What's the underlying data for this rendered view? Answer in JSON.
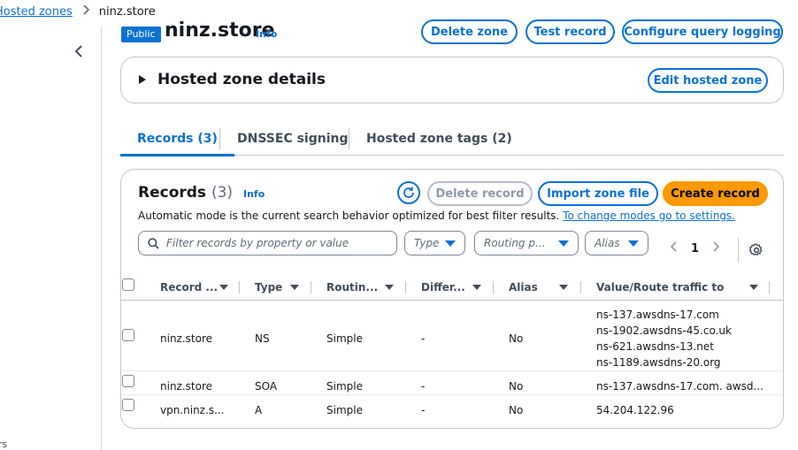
{
  "breadcrumb": {
    "parent": "Hosted zones",
    "current": "ninz.store"
  },
  "left_rail": {
    "fragment": "rs"
  },
  "header": {
    "badge": "Public",
    "title": "ninz.store",
    "info": "Info",
    "buttons": {
      "delete_zone": "Delete zone",
      "test_record": "Test record",
      "configure_logging": "Configure query logging"
    }
  },
  "details": {
    "title": "Hosted zone details",
    "edit_button": "Edit hosted zone"
  },
  "tabs": [
    {
      "label": "Records (3)",
      "active": true
    },
    {
      "label": "DNSSEC signing",
      "active": false
    },
    {
      "label": "Hosted zone tags (2)",
      "active": false
    }
  ],
  "records": {
    "title": "Records",
    "count": "(3)",
    "info": "Info",
    "buttons": {
      "delete": "Delete record",
      "import": "Import zone file",
      "create": "Create record"
    },
    "description": "Automatic mode is the current search behavior optimized for best filter results.",
    "description_link": "To change modes go to settings.",
    "search_placeholder": "Filter records by property or value",
    "filters": {
      "type": "Type",
      "routing": "Routing p...",
      "alias": "Alias"
    },
    "page": "1",
    "columns": {
      "record_name": "Record ...",
      "type": "Type",
      "routing": "Routin...",
      "differ": "Differ...",
      "alias": "Alias",
      "value": "Value/Route traffic to"
    },
    "rows": [
      {
        "name": "ninz.store",
        "type": "NS",
        "routing": "Simple",
        "differ": "-",
        "alias": "No",
        "values": [
          "ns-137.awsdns-17.com",
          "ns-1902.awsdns-45.co.uk",
          "ns-621.awsdns-13.net",
          "ns-1189.awsdns-20.org"
        ]
      },
      {
        "name": "ninz.store",
        "type": "SOA",
        "routing": "Simple",
        "differ": "-",
        "alias": "No",
        "values": [
          "ns-137.awsdns-17.com. awsd..."
        ]
      },
      {
        "name": "vpn.ninz.s...",
        "type": "A",
        "routing": "Simple",
        "differ": "-",
        "alias": "No",
        "values": [
          "54.204.122.96"
        ]
      }
    ]
  },
  "colors": {
    "accent": "#0972d3",
    "primary_button": "#ff9900",
    "border": "#c6c6cd"
  }
}
